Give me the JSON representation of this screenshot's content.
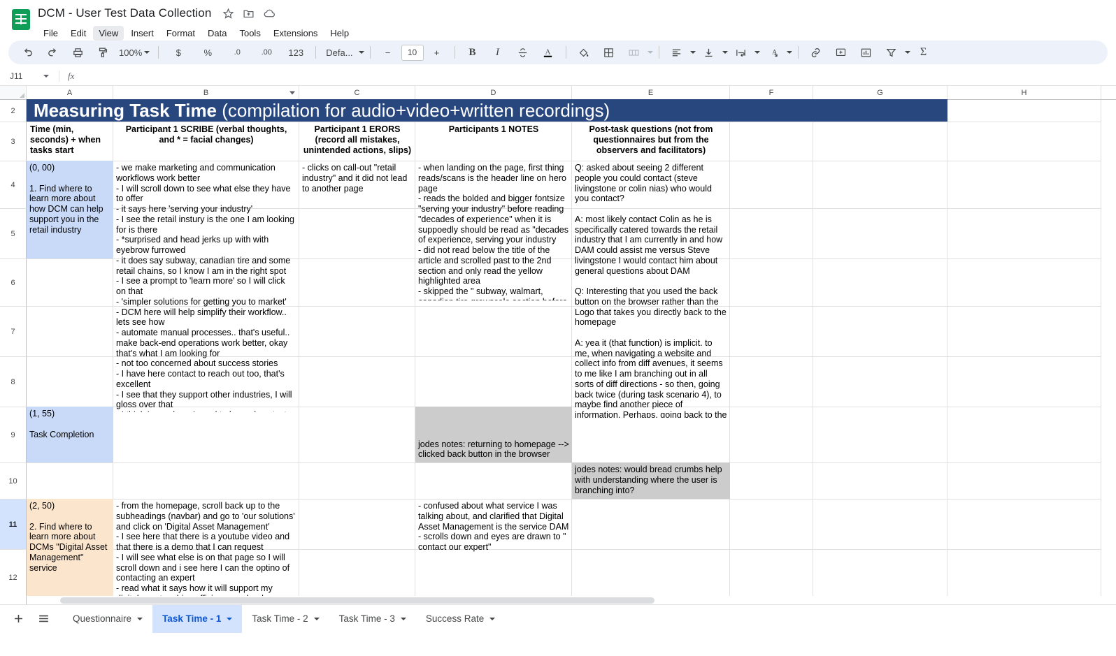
{
  "app": {
    "doc_title": "DCM - User Test Data Collection",
    "title_icons": [
      "star-icon",
      "move-to-folder-icon",
      "cloud-saved-icon"
    ],
    "menus": [
      "File",
      "Edit",
      "View",
      "Insert",
      "Format",
      "Data",
      "Tools",
      "Extensions",
      "Help"
    ],
    "active_menu": "View"
  },
  "toolbar": {
    "undo": "undo-icon",
    "redo": "redo-icon",
    "print": "print-icon",
    "paint_format": "paint-format-icon",
    "zoom": "100%",
    "currency": "$",
    "percent": "%",
    "decrease_decimal": ".0",
    "increase_decimal": ".00",
    "more_formats": "123",
    "font_name": "Defa...",
    "font_decrease": "−",
    "font_size": "10",
    "font_increase": "+",
    "bold": "B",
    "italic": "I",
    "strikethrough": "strikethrough-icon",
    "text_color": "A",
    "fill_color": "fill-color-icon",
    "borders": "borders-icon",
    "merge_cells": "merge-cells-icon",
    "horizontal_align": "horizontal-align-icon",
    "vertical_align": "vertical-align-icon",
    "text_wrap": "text-wrap-icon",
    "text_rotation": "text-rotation-icon",
    "insert_link": "link-icon",
    "insert_comment": "comment-icon",
    "insert_chart": "chart-icon",
    "create_filter": "filter-icon",
    "functions": "Σ"
  },
  "formula_bar": {
    "name_box": "J11",
    "fx_label": "fx",
    "value": ""
  },
  "grid": {
    "columns": [
      "A",
      "B",
      "C",
      "D",
      "E",
      "F",
      "G",
      "H"
    ],
    "selected_column": "",
    "filter_column": "B",
    "rows": [
      "2",
      "3",
      "4",
      "5",
      "6",
      "7",
      "8",
      "9",
      "10",
      "11",
      "12"
    ],
    "selected_row": "11",
    "banner": {
      "bold_part": "Measuring Task Time",
      "light_part": " (compilation for audio+video+written recordings)",
      "bg_color": "#27477e",
      "text_color": "#ffffff"
    },
    "headers": {
      "a": "Time (min, seconds) + when tasks start",
      "b": "Participant 1 SCRIBE (verbal thoughts, and * = facial changes)",
      "c": "Participant 1 ERORS (record all mistakes, unintended actions, slips)",
      "d": "Participants 1 NOTES",
      "e": "Post-task questions (not from questionnaires but from the observers and facilitators)"
    },
    "cells": {
      "a4": "(0, 00)\n\n1. Find where to learn more about how DCM can help support you in the retail industry",
      "b4": "- we make marketing and communication workflows work better\n- I will scroll down to see what else they have to offer\n- it says here 'serving your industry'\n- I see the retail instury is the one I am looking for is there\n- *surprised and head jerks up with with eyebrow furrowed\n- it does say subway, canadian tire and some retail chains, so I know I am in the right spot\n- I see a prompt to 'learn more' so I will click on that\n- 'simpler solutions for getting you to market'\n- DCM here will help simplify their workflow.. lets see how\n- automate manual processes.. that's useful.. make back-end operations work better, okay that's what I am looking for\n- not too concerned about success stories\n- I have here contact to reach out too, that's excellent\n- I see that they support other industries, I will gloss over that\n- I think I am where I need to be and contact Colin Nias",
      "c4": "- clicks on call-out \"retail industry\" and it did not lead to another page",
      "d4": "- when landing on the page, first thing reads/scans is the header line on hero page\n- reads the bolded and bigger fontsize \"serving your industry\" before reading \"decades of experience\" when it is suppoedly should be read as \"decades of experience, serving your industry\n- did not read below the title of the article and scrolled past to the 2nd section and only read the yellow highlighted area\n- skipped the \" subway, walmart, canadian tire grewscale section before contact section\"",
      "e4": "Q: asked about seeing 2 different people you could contact (steve livingstone or colin nias) who would you contact?\n\nA: most likely contact Colin as he is specifically catered towards the retail industry that I am currently in and how DAM could assist me versus Steve livingstone I would contact him about general questions about DAM\n\nQ: Interesting that you used the back button on the browser rather than the Logo that takes you directly back to the homepage\n\nA: yea it (that function) is implicit. to me, when navigating a website and collect info from diff avenues, it seems to me like I am branching out in all sorts of diff directions - so then, going back twice (during task scenario 4), to maybe find another piece of information. Perhaps, going back to the page before might give me a hint or indication rather than just going straight to the homepage and starting afresh",
      "a9": "(1, 55)\n\nTask Completion",
      "d9": "jodes notes: returning to homepage --> clicked back button in the browser",
      "e10": "jodes notes: would bread crumbs help with understanding where the user is branching into?",
      "a11": "(2, 50)\n\n2. Find where to learn more about DCMs \"Digital Asset Management\" service",
      "b11": "- from the homepage, scroll back up to the subheadings (navbar) and go to 'our solutions' and click on 'Digital Asset Management'\n- I see here that there is a youtube video and that there is a demo that I can request\n- I will see what else is on that page so I will scroll down and i see here I can the optino of contacting an expert\n- read what it says how it will support my digital assets...drive efficiency and reduce workflow redundancy, improve consistency and",
      "d11": "- confused about what service I was talking about, and clarified that Digital Asset Management is the service DAM\n- scrolls down and eyes are drawn to \" contact our expert\""
    },
    "fill_colors": {
      "task_blue": "#c9daf8",
      "task_orange": "#fce5cd",
      "notes_grey": "#cccccc"
    }
  },
  "sheetbar": {
    "add_sheet": "add-sheet-icon",
    "all_sheets": "all-sheets-icon",
    "tabs": [
      {
        "label": "Questionnaire",
        "active": false
      },
      {
        "label": "Task Time - 1",
        "active": true
      },
      {
        "label": "Task Time - 2",
        "active": false
      },
      {
        "label": "Task Time - 3",
        "active": false
      },
      {
        "label": "Success Rate",
        "active": false
      }
    ]
  }
}
